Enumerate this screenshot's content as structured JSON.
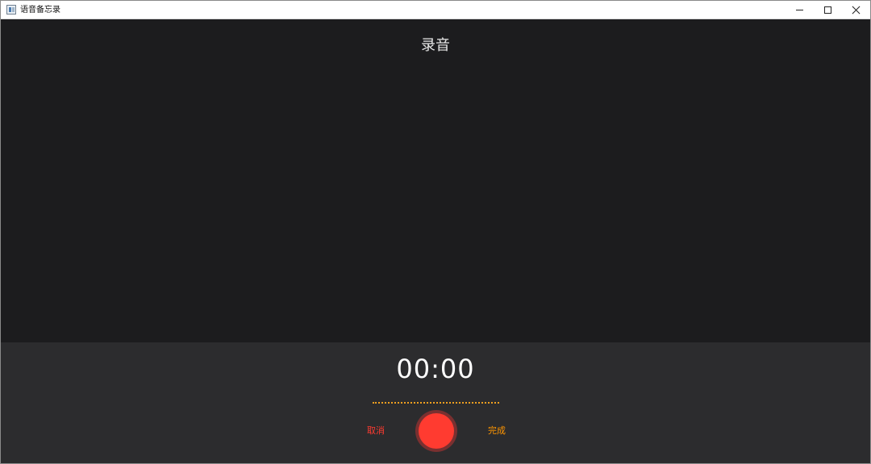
{
  "window": {
    "title": "语音备忘录"
  },
  "main": {
    "title": "录音"
  },
  "recorder": {
    "timer": "00:00",
    "cancel_label": "取消",
    "done_label": "完成"
  },
  "colors": {
    "background": "#1c1c1e",
    "panel": "#2c2c2e",
    "record_red": "#ff3b30",
    "done_orange": "#ff9500",
    "waveform": "#f0a020"
  },
  "icons": {
    "app": "app-icon",
    "minimize": "minimize-icon",
    "maximize": "maximize-icon",
    "close": "close-icon"
  }
}
